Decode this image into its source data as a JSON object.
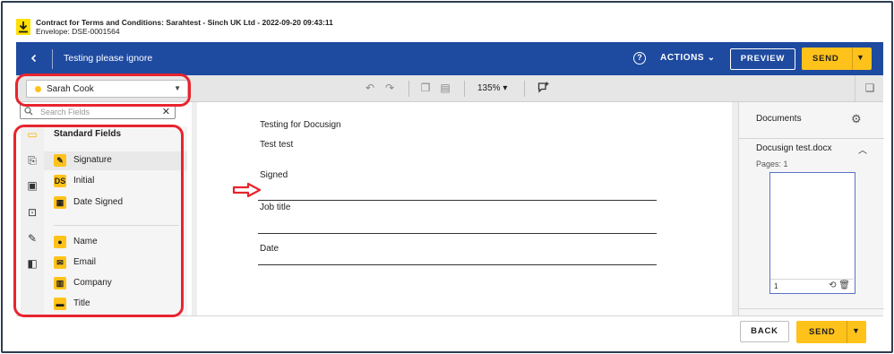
{
  "envelope": {
    "title": "Contract for Terms and Conditions: Sarahtest - Sinch UK Ltd - 2022-09-20 09:43:11",
    "id_label": "Envelope: DSE-0001564"
  },
  "topbar": {
    "back_icon": "chevron-left-icon",
    "title": "Testing please ignore",
    "help_icon": "help-icon",
    "actions_label": "ACTIONS ⌄",
    "preview_label": "PREVIEW",
    "send_label": "SEND",
    "bar_color": "#1e4aa0",
    "accent_color": "#ffc21a"
  },
  "toolbar": {
    "recipient_name": "Sarah Cook",
    "zoom_value": "135%  ▾",
    "undo_icon": "undo-icon",
    "redo_icon": "redo-icon",
    "copy_icon": "copy-icon",
    "paste_icon": "paste-icon",
    "comment_icon": "add-comment-icon",
    "pages_icon": "pages-icon"
  },
  "left_panel": {
    "search_placeholder": "Search Fields",
    "section_title": "Standard Fields",
    "fields": [
      {
        "label": "Signature",
        "icon": "signature-icon"
      },
      {
        "label": "Initial",
        "icon": "initial-icon"
      },
      {
        "label": "Date Signed",
        "icon": "calendar-icon"
      },
      {
        "label": "Name",
        "icon": "person-icon"
      },
      {
        "label": "Email",
        "icon": "email-icon"
      },
      {
        "label": "Company",
        "icon": "building-icon"
      },
      {
        "label": "Title",
        "icon": "briefcase-icon"
      }
    ]
  },
  "document": {
    "lines": [
      "Testing for Docusign",
      "Test test",
      "Signed",
      "Job title",
      "Date"
    ]
  },
  "right_panel": {
    "title": "Documents",
    "file_name": "Docusign test.docx",
    "pages_label": "Pages: 1",
    "page_number": "1"
  },
  "footer": {
    "back_label": "BACK",
    "send_label": "SEND"
  },
  "annotation_color": "#e8242e"
}
